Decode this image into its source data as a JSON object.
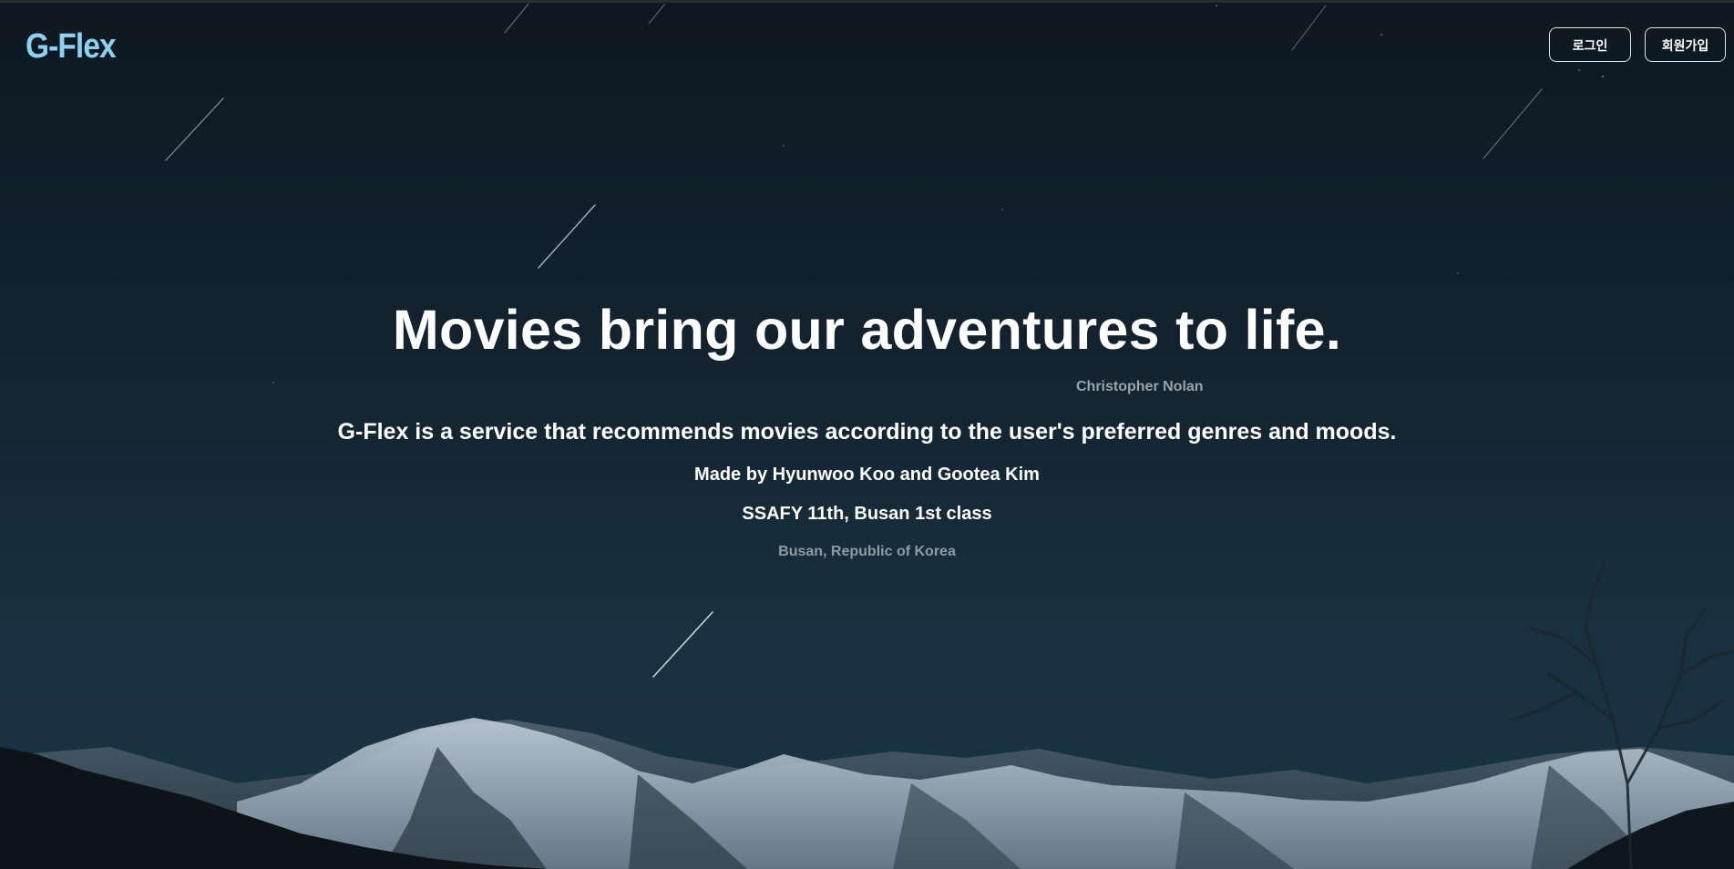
{
  "header": {
    "logo": "G-Flex",
    "login_label": "로그인",
    "signup_label": "회원가입"
  },
  "hero": {
    "headline": "Movies bring our adventures to life.",
    "quote_author": "Christopher Nolan",
    "description": "G-Flex is a service that recommends movies according to the user's preferred genres and moods.",
    "made_by": "Made by Hyunwoo Koo and Gootea Kim",
    "class_info": "SSAFY 11th, Busan 1st class",
    "location": "Busan, Republic of Korea"
  },
  "colors": {
    "logo": "#8ed0f0",
    "background": "#0f1a22",
    "text": "#ffffff",
    "muted_text": "#9aa3aa"
  }
}
